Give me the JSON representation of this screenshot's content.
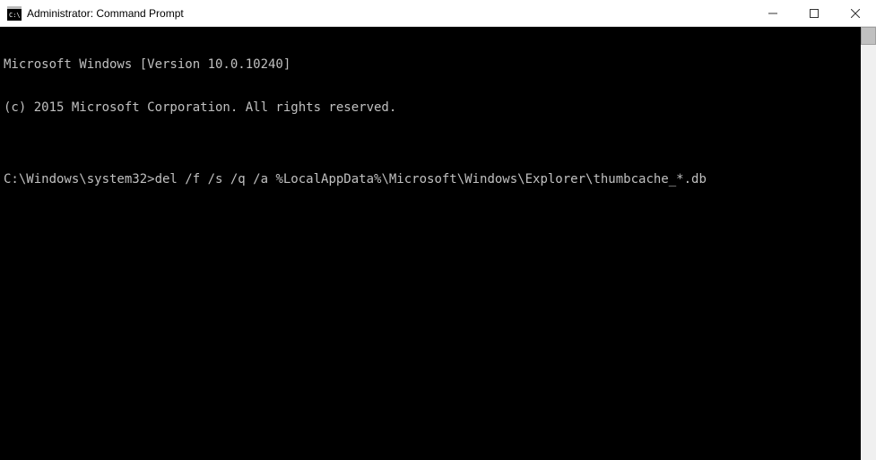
{
  "window": {
    "title": "Administrator: Command Prompt"
  },
  "console": {
    "lines": [
      "Microsoft Windows [Version 10.0.10240]",
      "(c) 2015 Microsoft Corporation. All rights reserved.",
      ""
    ],
    "prompt": "C:\\Windows\\system32>",
    "command": "del /f /s /q /a %LocalAppData%\\Microsoft\\Windows\\Explorer\\thumbcache_*.db"
  }
}
